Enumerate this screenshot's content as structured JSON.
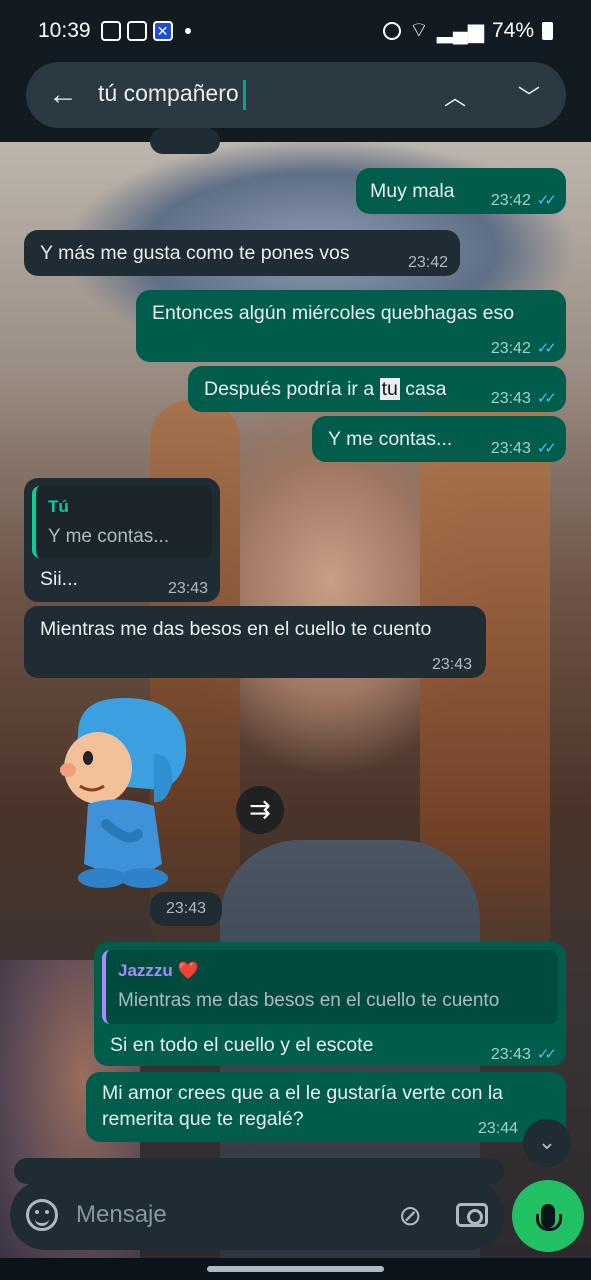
{
  "status_bar": {
    "time": "10:39",
    "battery": "74%"
  },
  "search": {
    "query": "tú compañero"
  },
  "messages": {
    "m1": {
      "text": "Muy mala",
      "time": "23:42"
    },
    "m2": {
      "text": "Y más me gusta como te pones vos",
      "time": "23:42"
    },
    "m3": {
      "text": "Entonces algún miércoles quebhagas eso",
      "time": "23:42"
    },
    "m4": {
      "text_before": "Después podría ir a ",
      "highlight": "tu",
      "text_after": " casa",
      "time": "23:43"
    },
    "m5": {
      "text": "Y me contas...",
      "time": "23:43"
    },
    "m6": {
      "quote_author": "Tú",
      "quote_text": "Y me contas...",
      "text": "Sii...",
      "time": "23:43"
    },
    "m7": {
      "text": "Mientras me das besos en el cuello te cuento",
      "time": "23:43"
    },
    "sticker": {
      "time": "23:43"
    },
    "m8": {
      "quote_author": "Jazzzu ❤️",
      "quote_text": "Mientras me das besos en el cuello te cuento",
      "text": "Si en todo el cuello y el escote",
      "time": "23:43"
    },
    "m9": {
      "text": "Mi amor crees que a el le gustaría verte con la remerita que te regalé?",
      "time": "23:44"
    }
  },
  "input": {
    "placeholder": "Mensaje"
  },
  "colors": {
    "outgoing": "#005c4b",
    "incoming": "#202c33",
    "accent": "#21c063"
  },
  "icons": [
    "back-arrow-icon",
    "chevron-up-icon",
    "chevron-down-icon",
    "forward-icon",
    "double-chevron-down-icon",
    "emoji-icon",
    "attach-icon",
    "camera-icon",
    "mic-icon"
  ]
}
